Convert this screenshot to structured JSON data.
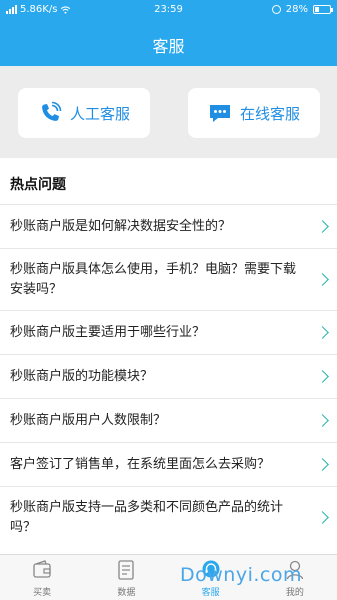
{
  "status_bar": {
    "network_speed": "5.86K/s",
    "time": "23:59",
    "battery_percent": "28%",
    "battery_level": 0.28
  },
  "header": {
    "title": "客服"
  },
  "service_buttons": {
    "human": {
      "label": "人工客服",
      "icon": "phone-icon"
    },
    "online": {
      "label": "在线客服",
      "icon": "chat-bubble-icon"
    }
  },
  "faq": {
    "title": "热点问题",
    "items": [
      "秒账商户版是如何解决数据安全性的？",
      "秒账商户版具体怎么使用，手机？电脑？需要下载安装吗？",
      "秒账商户版主要适用于哪些行业？",
      "秒账商户版的功能模块？",
      "秒账商户版用户人数限制？",
      "客户签订了销售单，在系统里面怎么去采购？",
      "秒账商户版支持一品多类和不同颜色产品的统计吗？"
    ]
  },
  "tabbar": {
    "tabs": [
      {
        "label": "买卖",
        "icon": "wallet-icon",
        "active": false
      },
      {
        "label": "数据",
        "icon": "document-icon",
        "active": false
      },
      {
        "label": "客服",
        "icon": "headset-icon",
        "active": true
      },
      {
        "label": "我的",
        "icon": "user-icon",
        "active": false
      }
    ]
  },
  "watermark": {
    "text": "Downyi.com"
  },
  "colors": {
    "primary": "#29a8ee",
    "accent_text": "#1f8ee3",
    "chevron": "#27b5a9"
  }
}
